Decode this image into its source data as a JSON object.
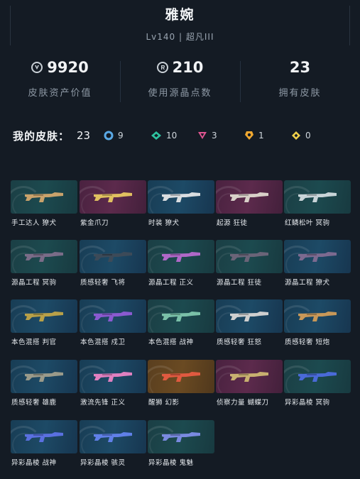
{
  "player": {
    "name": "雅婉",
    "level_rank": "Lv140 | 超凡III"
  },
  "stats": [
    {
      "value": "9920",
      "label": "皮肤资产价值",
      "icon": "valorant-points-icon"
    },
    {
      "value": "210",
      "label": "使用源晶点数",
      "icon": "radianite-icon"
    },
    {
      "value": "23",
      "label": "拥有皮肤",
      "icon": ""
    }
  ],
  "summary": {
    "label": "我的皮肤：",
    "total": "23",
    "tiers": [
      {
        "name": "select",
        "count": "9",
        "color": "#5aa9e6"
      },
      {
        "name": "deluxe",
        "count": "10",
        "color": "#2ec4a0"
      },
      {
        "name": "premium",
        "count": "3",
        "color": "#e05591"
      },
      {
        "name": "exclusive",
        "count": "1",
        "color": "#f0a830"
      },
      {
        "name": "ultra",
        "count": "0",
        "color": "#f2d14a"
      }
    ]
  },
  "skins": [
    {
      "name": "手工达人 獠犬",
      "tier": "select",
      "weapon": "#c9a26b"
    },
    {
      "name": "紫金爪刀",
      "tier": "premium",
      "weapon": "#e0c060"
    },
    {
      "name": "时装 獠犬",
      "tier": "deluxe",
      "weapon": "#d9dde0"
    },
    {
      "name": "起源 狂徒",
      "tier": "premium",
      "weapon": "#d8d0c8"
    },
    {
      "name": "红鳞松叶 冥驹",
      "tier": "select",
      "weapon": "#c8d4d8"
    },
    {
      "name": "源晶工程 冥驹",
      "tier": "select",
      "weapon": "#7a6c88"
    },
    {
      "name": "质感轻奢 飞将",
      "tier": "deluxe",
      "weapon": "#3c4a58"
    },
    {
      "name": "源晶工程 正义",
      "tier": "select",
      "weapon": "#b068c8"
    },
    {
      "name": "源晶工程 狂徒",
      "tier": "select",
      "weapon": "#6a6478"
    },
    {
      "name": "源晶工程 獠犬",
      "tier": "deluxe",
      "weapon": "#7c6a90"
    },
    {
      "name": "本色混搭 判官",
      "tier": "deluxe",
      "weapon": "#b8a048"
    },
    {
      "name": "本色混搭 戍卫",
      "tier": "deluxe",
      "weapon": "#8a5ad0"
    },
    {
      "name": "本色混搭 战神",
      "tier": "select",
      "weapon": "#7ac0a8"
    },
    {
      "name": "质感轻奢 狂怒",
      "tier": "deluxe",
      "weapon": "#cfcfcf"
    },
    {
      "name": "质感轻奢 短炮",
      "tier": "deluxe",
      "weapon": "#c89858"
    },
    {
      "name": "质感轻奢 雄鹿",
      "tier": "deluxe",
      "weapon": "#9a9a8a"
    },
    {
      "name": "激流先锋 正义",
      "tier": "deluxe",
      "weapon": "#e080c0"
    },
    {
      "name": "醒狮 幻影",
      "tier": "exclusive",
      "weapon": "#e05a40"
    },
    {
      "name": "侦察力量 蝴蝶刀",
      "tier": "premium",
      "weapon": "#c8b070"
    },
    {
      "name": "异彩晶棱 冥驹",
      "tier": "select",
      "weapon": "#4a6ad8"
    },
    {
      "name": "异彩晶棱 战神",
      "tier": "deluxe",
      "weapon": "#5a70e0"
    },
    {
      "name": "异彩晶棱 骇灵",
      "tier": "deluxe",
      "weapon": "#6080e8"
    },
    {
      "name": "异彩晶棱 鬼魅",
      "tier": "select",
      "weapon": "#7a8ae0"
    }
  ]
}
